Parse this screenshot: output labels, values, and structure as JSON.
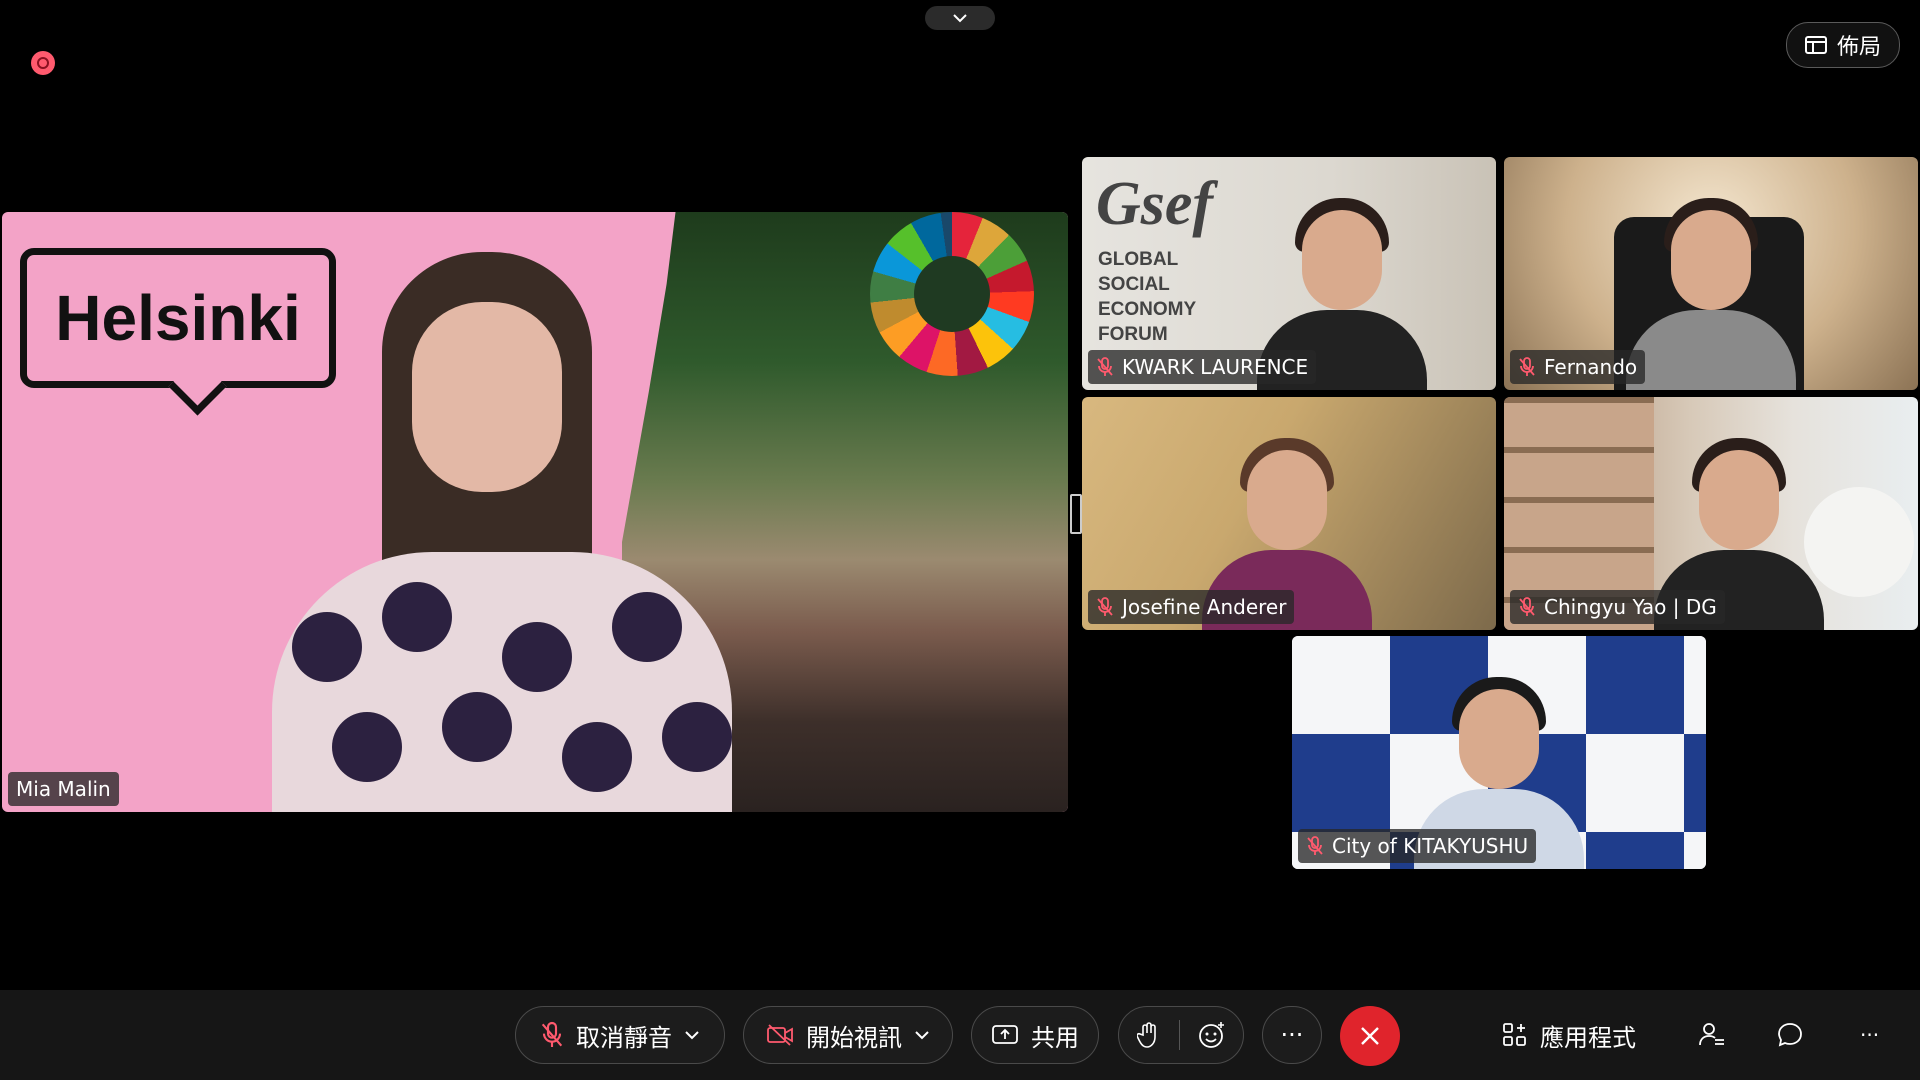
{
  "top": {
    "layout_label": "佈局"
  },
  "main_speaker": {
    "name": "Mia Malin",
    "logo_text": "Helsinki"
  },
  "participants": [
    {
      "name": "KWARK LAURENCE",
      "muted": true,
      "bg_title": "Gsef",
      "bg_subtitle": [
        "GLOBAL",
        "SOCIAL",
        "ECONOMY",
        "FORUM"
      ]
    },
    {
      "name": "Fernando",
      "muted": true
    },
    {
      "name": "Josefine Anderer",
      "muted": true
    },
    {
      "name": "Chingyu Yao | DG",
      "muted": true
    },
    {
      "name": "City of KITAKYUSHU",
      "muted": true
    }
  ],
  "toolbar": {
    "unmute_label": "取消靜音",
    "start_video_label": "開始視訊",
    "share_label": "共用",
    "apps_label": "應用程式",
    "more_label": "···"
  },
  "colors": {
    "end_call": "#e0242c",
    "record": "#ff5a6e",
    "main_bg": "#f3a3c7"
  }
}
